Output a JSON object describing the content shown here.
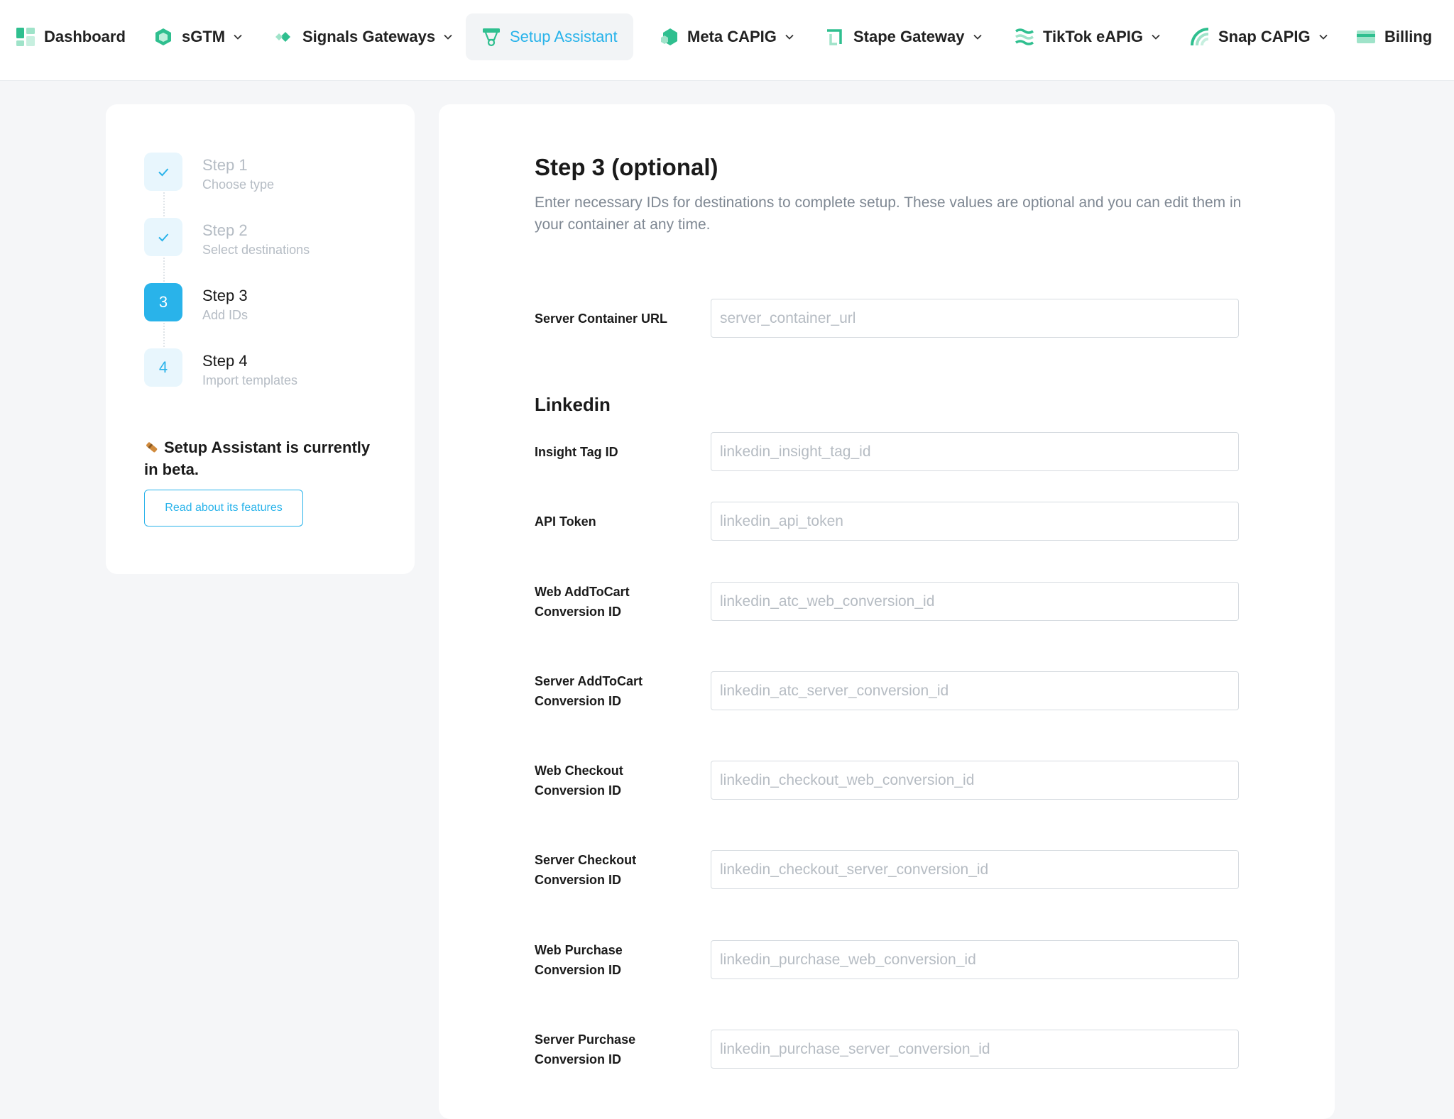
{
  "nav": {
    "items": [
      {
        "label": "Dashboard",
        "icon": "dashboard-icon",
        "dropdown": false
      },
      {
        "label": "sGTM",
        "icon": "cube-icon",
        "dropdown": true
      },
      {
        "label": "Signals Gateways",
        "icon": "signals-gateway-icon",
        "dropdown": true
      },
      {
        "label": "Setup Assistant",
        "icon": "setup-assistant-icon",
        "dropdown": false,
        "active": true
      },
      {
        "label": "Meta CAPIG",
        "icon": "hexagon-icon",
        "dropdown": true
      },
      {
        "label": "Stape Gateway",
        "icon": "gateway-icon",
        "dropdown": true
      },
      {
        "label": "TikTok eAPIG",
        "icon": "waves-icon",
        "dropdown": true
      },
      {
        "label": "Snap CAPIG",
        "icon": "signal-arc-icon",
        "dropdown": true
      },
      {
        "label": "Billing",
        "icon": "credit-card-icon",
        "dropdown": false
      }
    ]
  },
  "sidebar": {
    "steps": [
      {
        "title": "Step 1",
        "subtitle": "Choose type",
        "state": "done"
      },
      {
        "title": "Step 2",
        "subtitle": "Select destinations",
        "state": "done"
      },
      {
        "title": "Step 3",
        "number": "3",
        "subtitle": "Add IDs",
        "state": "current"
      },
      {
        "title": "Step 4",
        "number": "4",
        "subtitle": "Import templates",
        "state": "pending"
      }
    ],
    "beta_text": "Setup Assistant is currently in beta.",
    "read_button": "Read about its features"
  },
  "main": {
    "title": "Step 3 (optional)",
    "description": "Enter necessary IDs for destinations to complete setup. These values are optional and you can edit them in your container at any time.",
    "server_url": {
      "label": "Server Container URL",
      "placeholder": "server_container_url",
      "value": ""
    },
    "section": "Linkedin",
    "fields": [
      {
        "label": "Insight Tag ID",
        "placeholder": "linkedin_insight_tag_id",
        "value": ""
      },
      {
        "label": "API Token",
        "placeholder": "linkedin_api_token",
        "value": ""
      },
      {
        "label": "Web AddToCart Conversion ID",
        "placeholder": "linkedin_atc_web_conversion_id",
        "value": ""
      },
      {
        "label": "Server AddToCart Conversion ID",
        "placeholder": "linkedin_atc_server_conversion_id",
        "value": ""
      },
      {
        "label": "Web Checkout Conversion ID",
        "placeholder": "linkedin_checkout_web_conversion_id",
        "value": ""
      },
      {
        "label": "Server Checkout Conversion ID",
        "placeholder": "linkedin_checkout_server_conversion_id",
        "value": ""
      },
      {
        "label": "Web Purchase Conversion ID",
        "placeholder": "linkedin_purchase_web_conversion_id",
        "value": ""
      },
      {
        "label": "Server Purchase Conversion ID",
        "placeholder": "linkedin_purchase_server_conversion_id",
        "value": ""
      }
    ]
  },
  "colors": {
    "accent": "#29b3ea",
    "brand_green": "#2fbf8f",
    "background": "#f5f6f8"
  }
}
